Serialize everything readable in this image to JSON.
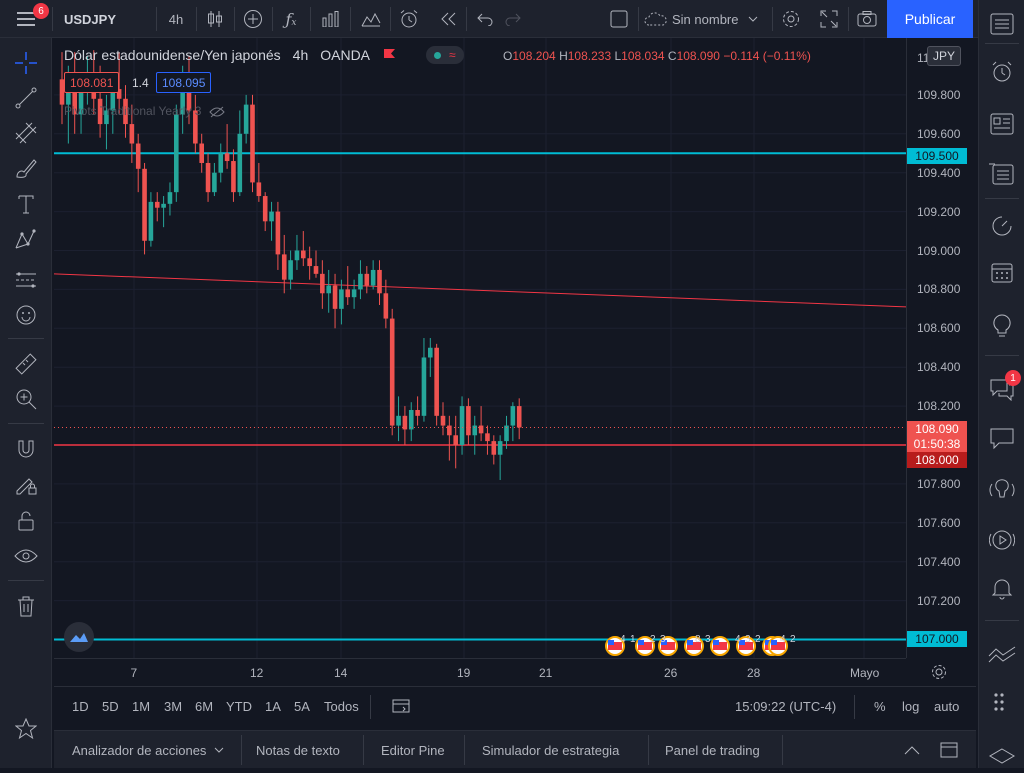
{
  "topbar": {
    "menu_badge": "6",
    "symbol": "USDJPY",
    "interval": "4h",
    "layout_name": "Sin nombre",
    "publish_label": "Publicar"
  },
  "legend": {
    "title": "Dólar estadounidense/Yen japonés",
    "interval": "4h",
    "source": "OANDA",
    "o_label": "O",
    "o_value": "108.204",
    "h_label": "H",
    "h_value": "108.233",
    "l_label": "L",
    "l_value": "108.034",
    "c_label": "C",
    "c_value": "108.090",
    "change": "−0.114 (−0.11%)",
    "sell_price": "108.081",
    "spread": "1.4",
    "buy_price": "108.095",
    "indicator": "Pivots Traditional Yearly 3"
  },
  "price_axis": {
    "currency": "JPY",
    "ticks": [
      "109.800",
      "109.600",
      "109.400",
      "109.200",
      "109.000",
      "108.800",
      "108.600",
      "108.400",
      "108.200",
      "107.800",
      "107.600",
      "107.400",
      "107.200"
    ],
    "top_tick_partial": "11",
    "line_109500": "109.500",
    "current_price": "108.090",
    "countdown": "01:50:38",
    "line_108000": "108.000",
    "line_107000": "107.000"
  },
  "time_axis": {
    "ticks": [
      "7",
      "12",
      "14",
      "19",
      "21",
      "26",
      "28",
      "Mayo"
    ]
  },
  "events": [
    "4",
    "1",
    "2",
    "3",
    "8",
    "3",
    "4",
    "3",
    "2",
    "4",
    "2"
  ],
  "range_bar": {
    "ranges": [
      "1D",
      "5D",
      "1M",
      "3M",
      "6M",
      "YTD",
      "1A",
      "5A",
      "Todos"
    ],
    "clock": "15:09:22 (UTC-4)",
    "percent": "%",
    "log": "log",
    "auto": "auto"
  },
  "bottom_tabs": [
    "Analizador de acciones",
    "Notas de texto",
    "Editor Pine",
    "Simulador de estrategia",
    "Panel de trading"
  ],
  "rightbar": {
    "chat_badge": "1"
  },
  "colors": {
    "up": "#26a69a",
    "down": "#ef5350",
    "cyan": "#00bcd4",
    "red_line": "#f23645",
    "accent": "#2962ff"
  },
  "chart_data": {
    "type": "candlestick",
    "symbol": "USDJPY",
    "interval": "4h",
    "ylim": [
      106.9,
      110.05
    ],
    "x_labels": [
      "7",
      "12",
      "14",
      "19",
      "21",
      "26",
      "28",
      "Mayo"
    ],
    "horizontal_lines": [
      109.5,
      108.0,
      107.0
    ],
    "trendline": [
      [
        0,
        108.88
      ],
      [
        111,
        108.71
      ]
    ],
    "candles": [
      {
        "i": 0,
        "o": 109.88,
        "h": 110.02,
        "l": 109.65,
        "c": 109.75
      },
      {
        "i": 1,
        "o": 109.75,
        "h": 109.95,
        "l": 109.55,
        "c": 109.82
      },
      {
        "i": 2,
        "o": 109.82,
        "h": 110.02,
        "l": 109.6,
        "c": 109.7
      },
      {
        "i": 3,
        "o": 109.7,
        "h": 109.9,
        "l": 109.6,
        "c": 109.85
      },
      {
        "i": 4,
        "o": 109.85,
        "h": 110.0,
        "l": 109.75,
        "c": 109.9
      },
      {
        "i": 5,
        "o": 109.9,
        "h": 110.03,
        "l": 109.7,
        "c": 109.78
      },
      {
        "i": 6,
        "o": 109.78,
        "h": 109.95,
        "l": 109.58,
        "c": 109.65
      },
      {
        "i": 7,
        "o": 109.65,
        "h": 109.8,
        "l": 109.52,
        "c": 109.72
      },
      {
        "i": 8,
        "o": 109.72,
        "h": 109.9,
        "l": 109.6,
        "c": 109.83
      },
      {
        "i": 9,
        "o": 109.83,
        "h": 110.02,
        "l": 109.7,
        "c": 109.78
      },
      {
        "i": 10,
        "o": 109.78,
        "h": 109.85,
        "l": 109.58,
        "c": 109.65
      },
      {
        "i": 11,
        "o": 109.65,
        "h": 109.75,
        "l": 109.45,
        "c": 109.55
      },
      {
        "i": 12,
        "o": 109.55,
        "h": 109.6,
        "l": 109.3,
        "c": 109.42
      },
      {
        "i": 13,
        "o": 109.42,
        "h": 109.45,
        "l": 108.98,
        "c": 109.05
      },
      {
        "i": 14,
        "o": 109.05,
        "h": 109.3,
        "l": 109.02,
        "c": 109.25
      },
      {
        "i": 15,
        "o": 109.25,
        "h": 109.3,
        "l": 109.15,
        "c": 109.22
      },
      {
        "i": 16,
        "o": 109.22,
        "h": 109.28,
        "l": 109.12,
        "c": 109.24
      },
      {
        "i": 17,
        "o": 109.24,
        "h": 109.35,
        "l": 109.18,
        "c": 109.3
      },
      {
        "i": 18,
        "o": 109.3,
        "h": 109.75,
        "l": 109.25,
        "c": 109.7
      },
      {
        "i": 19,
        "o": 109.7,
        "h": 109.95,
        "l": 109.6,
        "c": 109.85
      },
      {
        "i": 20,
        "o": 109.85,
        "h": 110.0,
        "l": 109.65,
        "c": 109.72
      },
      {
        "i": 21,
        "o": 109.72,
        "h": 109.8,
        "l": 109.5,
        "c": 109.55
      },
      {
        "i": 22,
        "o": 109.55,
        "h": 109.6,
        "l": 109.4,
        "c": 109.45
      },
      {
        "i": 23,
        "o": 109.45,
        "h": 109.5,
        "l": 109.25,
        "c": 109.3
      },
      {
        "i": 24,
        "o": 109.3,
        "h": 109.45,
        "l": 109.28,
        "c": 109.4
      },
      {
        "i": 25,
        "o": 109.4,
        "h": 109.55,
        "l": 109.35,
        "c": 109.5
      },
      {
        "i": 26,
        "o": 109.5,
        "h": 109.65,
        "l": 109.42,
        "c": 109.46
      },
      {
        "i": 27,
        "o": 109.46,
        "h": 109.52,
        "l": 109.25,
        "c": 109.3
      },
      {
        "i": 28,
        "o": 109.3,
        "h": 109.72,
        "l": 109.28,
        "c": 109.6
      },
      {
        "i": 29,
        "o": 109.6,
        "h": 109.8,
        "l": 109.55,
        "c": 109.75
      },
      {
        "i": 30,
        "o": 109.75,
        "h": 109.8,
        "l": 109.3,
        "c": 109.35
      },
      {
        "i": 31,
        "o": 109.35,
        "h": 109.45,
        "l": 109.25,
        "c": 109.28
      },
      {
        "i": 32,
        "o": 109.28,
        "h": 109.3,
        "l": 109.1,
        "c": 109.15
      },
      {
        "i": 33,
        "o": 109.15,
        "h": 109.25,
        "l": 109.05,
        "c": 109.2
      },
      {
        "i": 34,
        "o": 109.2,
        "h": 109.25,
        "l": 108.9,
        "c": 108.98
      },
      {
        "i": 35,
        "o": 108.98,
        "h": 109.08,
        "l": 108.78,
        "c": 108.85
      },
      {
        "i": 36,
        "o": 108.85,
        "h": 109.0,
        "l": 108.8,
        "c": 108.95
      },
      {
        "i": 37,
        "o": 108.95,
        "h": 109.08,
        "l": 108.9,
        "c": 109.0
      },
      {
        "i": 38,
        "o": 109.0,
        "h": 109.1,
        "l": 108.92,
        "c": 108.96
      },
      {
        "i": 39,
        "o": 108.96,
        "h": 109.02,
        "l": 108.85,
        "c": 108.92
      },
      {
        "i": 40,
        "o": 108.92,
        "h": 109.0,
        "l": 108.86,
        "c": 108.88
      },
      {
        "i": 41,
        "o": 108.88,
        "h": 108.95,
        "l": 108.7,
        "c": 108.78
      },
      {
        "i": 42,
        "o": 108.78,
        "h": 108.9,
        "l": 108.68,
        "c": 108.82
      },
      {
        "i": 43,
        "o": 108.82,
        "h": 108.88,
        "l": 108.6,
        "c": 108.7
      },
      {
        "i": 44,
        "o": 108.7,
        "h": 108.85,
        "l": 108.62,
        "c": 108.8
      },
      {
        "i": 45,
        "o": 108.8,
        "h": 108.92,
        "l": 108.72,
        "c": 108.76
      },
      {
        "i": 46,
        "o": 108.76,
        "h": 108.85,
        "l": 108.7,
        "c": 108.8
      },
      {
        "i": 47,
        "o": 108.8,
        "h": 108.95,
        "l": 108.75,
        "c": 108.88
      },
      {
        "i": 48,
        "o": 108.88,
        "h": 108.92,
        "l": 108.78,
        "c": 108.82
      },
      {
        "i": 49,
        "o": 108.82,
        "h": 108.95,
        "l": 108.8,
        "c": 108.9
      },
      {
        "i": 50,
        "o": 108.9,
        "h": 108.95,
        "l": 108.72,
        "c": 108.78
      },
      {
        "i": 51,
        "o": 108.78,
        "h": 108.85,
        "l": 108.6,
        "c": 108.65
      },
      {
        "i": 52,
        "o": 108.65,
        "h": 108.7,
        "l": 108.05,
        "c": 108.1
      },
      {
        "i": 53,
        "o": 108.1,
        "h": 108.25,
        "l": 108.02,
        "c": 108.15
      },
      {
        "i": 54,
        "o": 108.15,
        "h": 108.2,
        "l": 108.0,
        "c": 108.08
      },
      {
        "i": 55,
        "o": 108.08,
        "h": 108.22,
        "l": 108.02,
        "c": 108.18
      },
      {
        "i": 56,
        "o": 108.18,
        "h": 108.25,
        "l": 108.1,
        "c": 108.15
      },
      {
        "i": 57,
        "o": 108.15,
        "h": 108.55,
        "l": 108.12,
        "c": 108.45
      },
      {
        "i": 58,
        "o": 108.45,
        "h": 108.55,
        "l": 108.35,
        "c": 108.5
      },
      {
        "i": 59,
        "o": 108.5,
        "h": 108.52,
        "l": 108.1,
        "c": 108.15
      },
      {
        "i": 60,
        "o": 108.15,
        "h": 108.22,
        "l": 108.05,
        "c": 108.1
      },
      {
        "i": 61,
        "o": 108.1,
        "h": 108.15,
        "l": 107.92,
        "c": 108.05
      },
      {
        "i": 62,
        "o": 108.05,
        "h": 108.15,
        "l": 107.88,
        "c": 108.0
      },
      {
        "i": 63,
        "o": 108.0,
        "h": 108.25,
        "l": 107.95,
        "c": 108.2
      },
      {
        "i": 64,
        "o": 108.2,
        "h": 108.24,
        "l": 108.0,
        "c": 108.05
      },
      {
        "i": 65,
        "o": 108.05,
        "h": 108.15,
        "l": 107.95,
        "c": 108.1
      },
      {
        "i": 66,
        "o": 108.1,
        "h": 108.2,
        "l": 108.02,
        "c": 108.06
      },
      {
        "i": 67,
        "o": 108.06,
        "h": 108.1,
        "l": 107.95,
        "c": 108.02
      },
      {
        "i": 68,
        "o": 108.02,
        "h": 108.05,
        "l": 107.9,
        "c": 107.95
      },
      {
        "i": 69,
        "o": 107.95,
        "h": 108.05,
        "l": 107.82,
        "c": 108.02
      },
      {
        "i": 70,
        "o": 108.02,
        "h": 108.15,
        "l": 107.98,
        "c": 108.1
      },
      {
        "i": 71,
        "o": 108.1,
        "h": 108.22,
        "l": 108.02,
        "c": 108.2
      },
      {
        "i": 72,
        "o": 108.2,
        "h": 108.24,
        "l": 108.03,
        "c": 108.09
      }
    ]
  }
}
